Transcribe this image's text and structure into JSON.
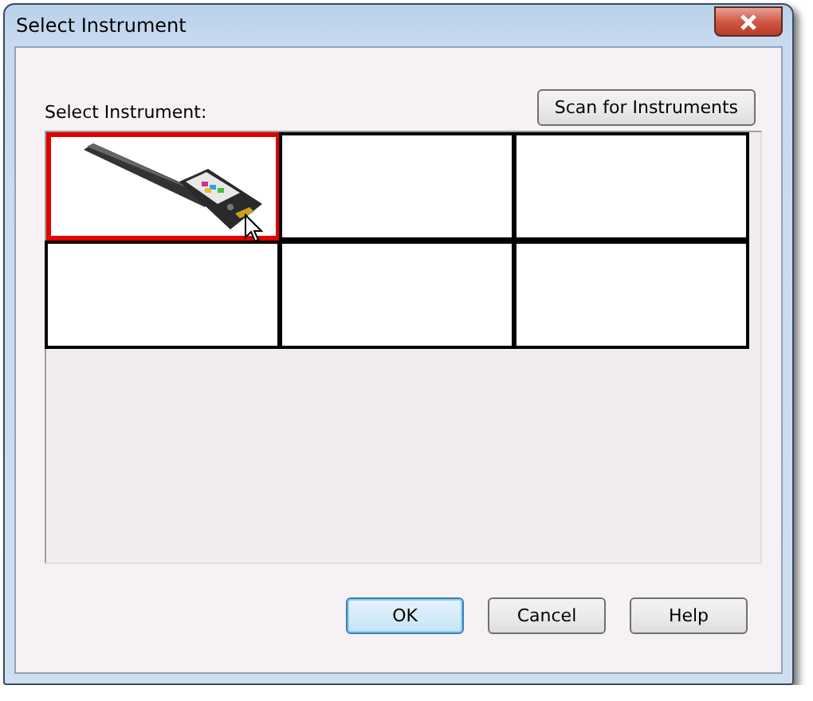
{
  "window": {
    "title": "Select Instrument"
  },
  "label": "Select Instrument:",
  "scan_button": "Scan for Instruments",
  "slots": [
    {
      "kind": "instrument",
      "selected": true
    },
    {
      "kind": "empty",
      "selected": false
    },
    {
      "kind": "empty",
      "selected": false
    },
    {
      "kind": "empty",
      "selected": false
    },
    {
      "kind": "empty",
      "selected": false
    },
    {
      "kind": "empty",
      "selected": false
    }
  ],
  "buttons": [
    {
      "label": "OK",
      "default": true
    },
    {
      "label": "Cancel",
      "default": false
    },
    {
      "label": "Help",
      "default": false
    }
  ]
}
